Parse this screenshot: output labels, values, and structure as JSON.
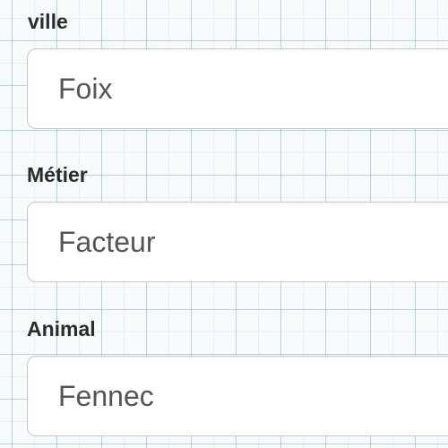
{
  "form": {
    "fields": [
      {
        "label": "ville",
        "value": "Foix"
      },
      {
        "label": "Métier",
        "value": "Facteur"
      },
      {
        "label": "Animal",
        "value": "Fennec"
      }
    ]
  },
  "colors": {
    "label": "#2b2b2b",
    "input_text": "#555555",
    "input_border": "#c9c9c9",
    "grid": "#78afbe"
  }
}
